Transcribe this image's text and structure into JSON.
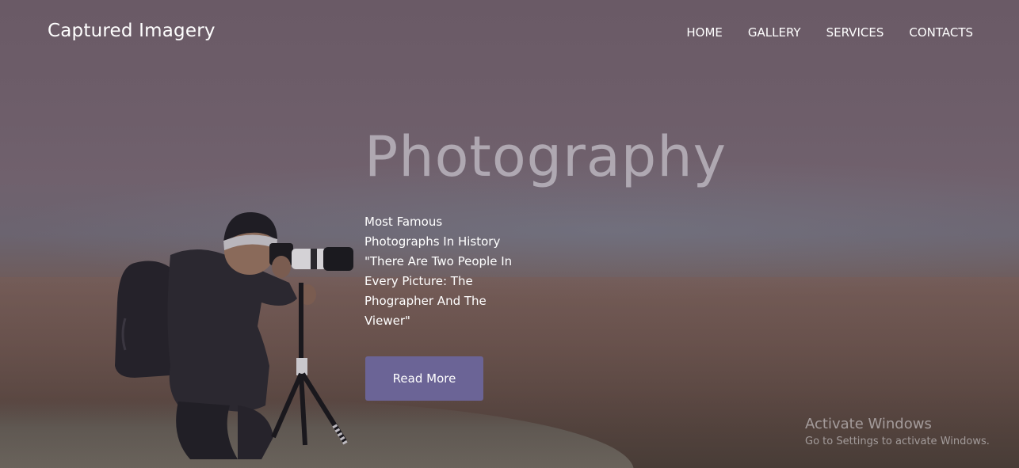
{
  "brand": "Captured Imagery",
  "nav": {
    "items": [
      "HOME",
      "GALLERY",
      "SERVICES",
      "CONTACTS"
    ]
  },
  "hero": {
    "headline": "Photography",
    "quote_lines": [
      "Most Famous",
      "Photographs In History",
      "\"There Are Two People In",
      "Every Picture: The",
      "Phographer And The",
      "Viewer\""
    ],
    "cta_label": "Read More"
  },
  "watermark": {
    "title": "Activate Windows",
    "subtitle": "Go to Settings to activate Windows."
  },
  "colors": {
    "button": "#6b6496",
    "headline": "#c8c4cc"
  }
}
